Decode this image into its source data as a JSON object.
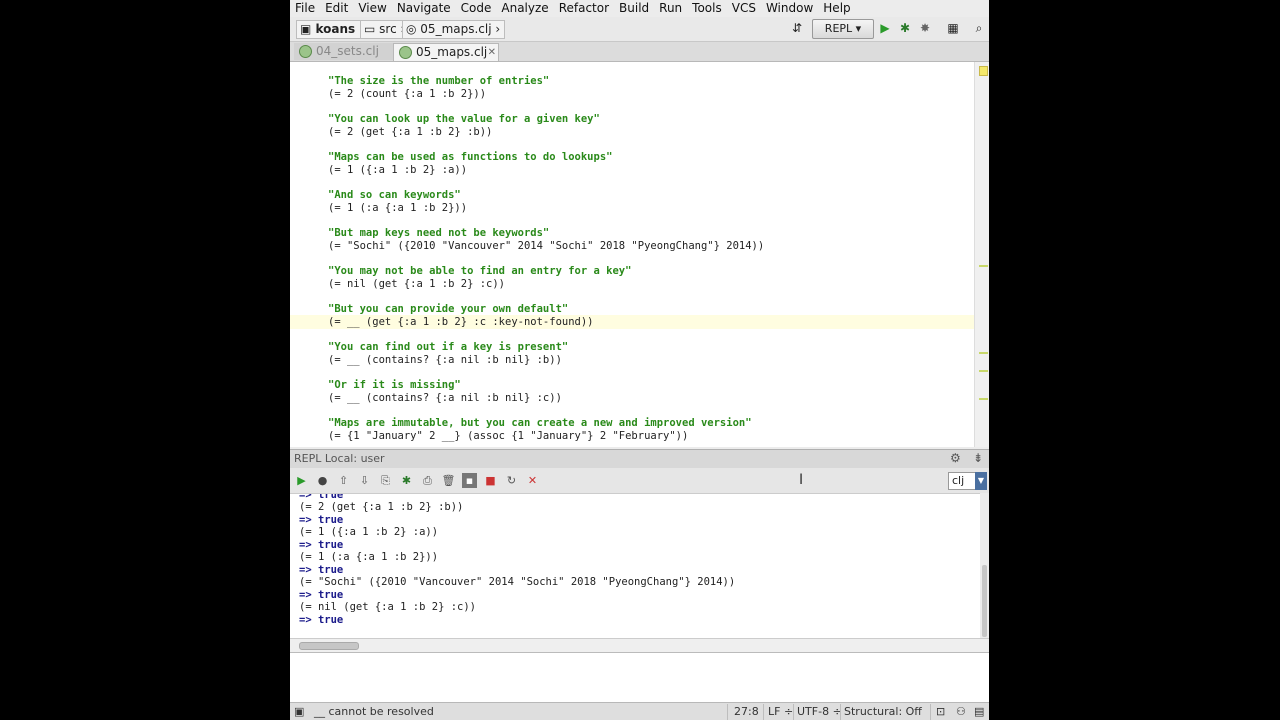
{
  "menu": [
    "File",
    "Edit",
    "View",
    "Navigate",
    "Code",
    "Analyze",
    "Refactor",
    "Build",
    "Run",
    "Tools",
    "VCS",
    "Window",
    "Help"
  ],
  "breadcrumb": {
    "project": "koans",
    "folder": "src",
    "file": "05_maps.clj"
  },
  "toolbar": {
    "repl_label": "REPL"
  },
  "tabs": [
    {
      "label": "04_sets.clj",
      "active": false
    },
    {
      "label": "05_maps.clj",
      "active": true
    }
  ],
  "editor": {
    "lines": [
      {
        "kind": "str",
        "text": "\"The size is the number of entries\""
      },
      {
        "kind": "code",
        "text": "(= 2 (count {:a 1 :b 2}))"
      },
      {
        "kind": "str",
        "text": "\"You can look up the value for a given key\""
      },
      {
        "kind": "code",
        "text": "(= 2 (get {:a 1 :b 2} :b))"
      },
      {
        "kind": "str",
        "text": "\"Maps can be used as functions to do lookups\""
      },
      {
        "kind": "code",
        "text": "(= 1 ({:a 1 :b 2} :a))"
      },
      {
        "kind": "str",
        "text": "\"And so can keywords\""
      },
      {
        "kind": "code",
        "text": "(= 1 (:a {:a 1 :b 2}))"
      },
      {
        "kind": "str",
        "text": "\"But map keys need not be keywords\""
      },
      {
        "kind": "code",
        "text": "(= \"Sochi\" ({2010 \"Vancouver\" 2014 \"Sochi\" 2018 \"PyeongChang\"} 2014))"
      },
      {
        "kind": "str",
        "text": "\"You may not be able to find an entry for a key\""
      },
      {
        "kind": "code",
        "text": "(= nil (get {:a 1 :b 2} :c))"
      },
      {
        "kind": "str",
        "text": "\"But you can provide your own default\""
      },
      {
        "kind": "code",
        "text": "(= __ (get {:a 1 :b 2} :c :key-not-found))"
      },
      {
        "kind": "str",
        "text": "\"You can find out if a key is present\""
      },
      {
        "kind": "code",
        "text": "(= __ (contains? {:a nil :b nil} :b))"
      },
      {
        "kind": "str",
        "text": "\"Or if it is missing\""
      },
      {
        "kind": "code",
        "text": "(= __ (contains? {:a nil :b nil} :c))"
      },
      {
        "kind": "str",
        "text": "\"Maps are immutable, but you can create a new and improved version\""
      },
      {
        "kind": "code",
        "text": "(= {1 \"January\" 2 __} (assoc {1 \"January\"} 2 \"February\"))"
      }
    ]
  },
  "repl": {
    "header": "REPL Local: user",
    "lang_select": "clj",
    "output": [
      "=> true",
      "(= 2 (get {:a 1 :b 2} :b))",
      "=> true",
      "(= 1 ({:a 1 :b 2} :a))",
      "=> true",
      "(= 1 (:a {:a 1 :b 2}))",
      "=> true",
      "(= \"Sochi\" ({2010 \"Vancouver\" 2014 \"Sochi\" 2018 \"PyeongChang\"} 2014))",
      "=> true",
      "(= nil (get {:a 1 :b 2} :c))",
      "=> true"
    ]
  },
  "status": {
    "message": "__ cannot be resolved",
    "position": "27:8",
    "line_sep": "LF",
    "encoding": "UTF-8",
    "mode": "Structural: Off"
  }
}
